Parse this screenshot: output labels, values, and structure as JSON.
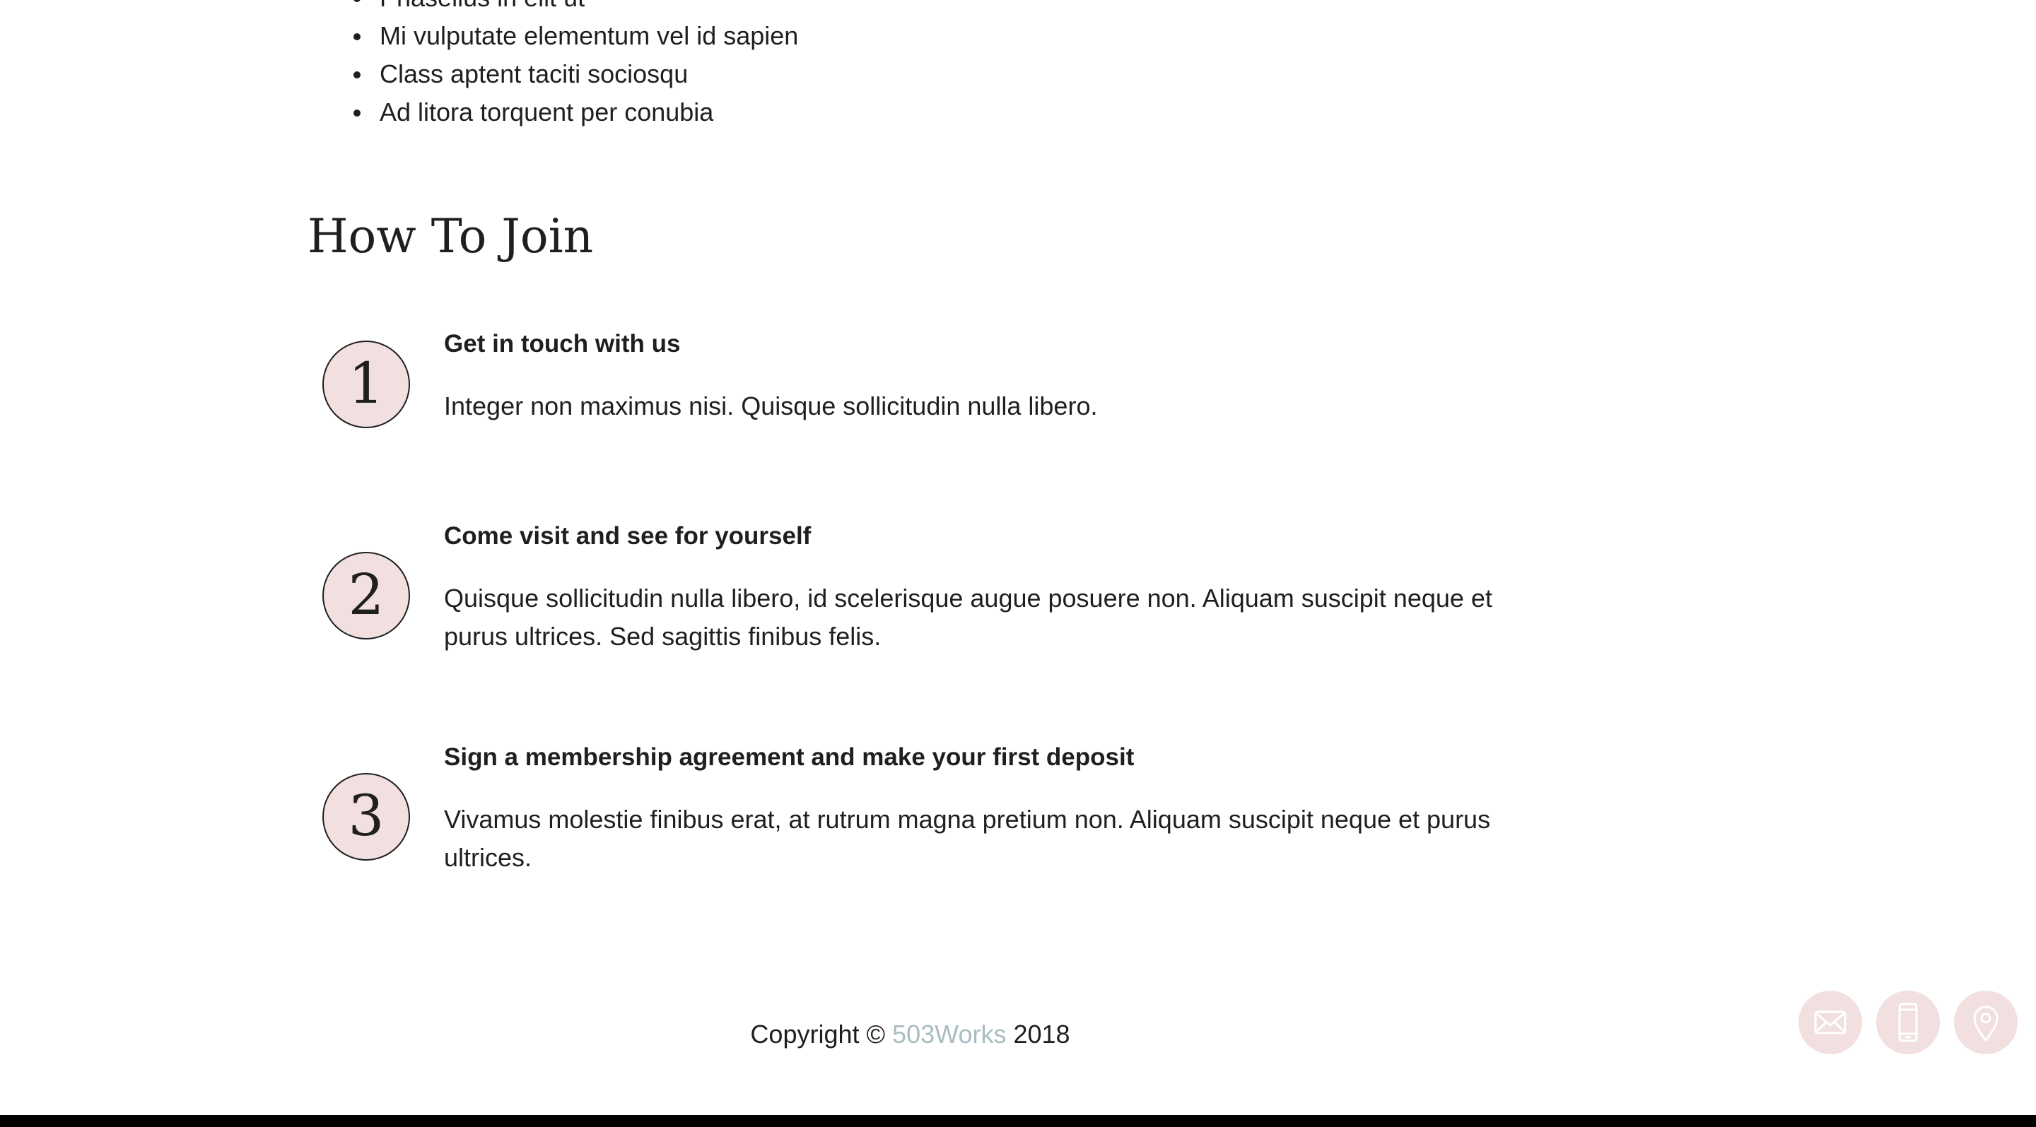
{
  "features_list": [
    "Phasellus in elit ut",
    "Mi vulputate elementum vel id sapien",
    "Class aptent taciti sociosqu",
    "Ad litora torquent per conubia"
  ],
  "how_to_join": {
    "title": "How To Join",
    "steps": [
      {
        "number": "1",
        "heading": "Get in touch with us",
        "text": "Integer non maximus nisi. Quisque sollicitudin nulla libero."
      },
      {
        "number": "2",
        "heading": "Come visit and see for yourself",
        "text": "Quisque sollicitudin nulla libero, id scelerisque augue posuere non. Aliquam suscipit neque et purus ultrices. Sed sagittis finibus felis."
      },
      {
        "number": "3",
        "heading": "Sign a membership agreement and make your first deposit",
        "text": "Vivamus molestie finibus erat, at rutrum magna pretium non. Aliquam suscipit neque et purus ultrices."
      }
    ]
  },
  "footer": {
    "copyright_prefix": "Copyright ©",
    "company_link": "503Works",
    "year": "2018"
  },
  "contact_buttons": [
    {
      "icon": "envelope-icon"
    },
    {
      "icon": "phone-icon"
    },
    {
      "icon": "map-pin-icon"
    }
  ],
  "colors": {
    "accent_circle": "#f1e0df",
    "link": "#a9bdc1",
    "text": "#1f1f1f"
  }
}
